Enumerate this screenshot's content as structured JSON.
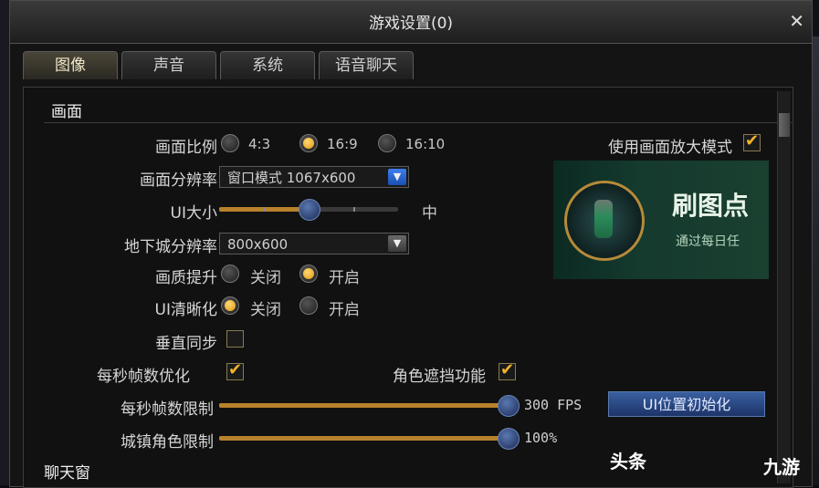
{
  "window": {
    "title": "游戏设置(0)",
    "close_label": "✕"
  },
  "tabs": [
    {
      "label": "图像",
      "active": true
    },
    {
      "label": "声音",
      "active": false
    },
    {
      "label": "系统",
      "active": false
    },
    {
      "label": "语音聊天",
      "active": false
    }
  ],
  "sections": {
    "display": "画面",
    "chat": "聊天窗"
  },
  "aspect_ratio": {
    "label": "画面比例",
    "options": [
      {
        "label": "4:3",
        "selected": false
      },
      {
        "label": "16:9",
        "selected": true
      },
      {
        "label": "16:10",
        "selected": false
      }
    ]
  },
  "zoom_mode": {
    "label": "使用画面放大模式",
    "checked": true
  },
  "resolution": {
    "label": "画面分辨率",
    "value": "窗口模式 1067x600"
  },
  "ui_size": {
    "label": "UI大小",
    "value_label": "中",
    "level": 0.5
  },
  "dungeon_resolution": {
    "label": "地下城分辨率",
    "value": "800x600"
  },
  "quality_boost": {
    "label": "画质提升",
    "options": [
      {
        "label": "关闭",
        "selected": false
      },
      {
        "label": "开启",
        "selected": true
      }
    ]
  },
  "ui_sharpen": {
    "label": "UI清晰化",
    "options": [
      {
        "label": "关闭",
        "selected": true
      },
      {
        "label": "开启",
        "selected": false
      }
    ]
  },
  "vsync": {
    "label": "垂直同步",
    "checked": false
  },
  "fps_optimize": {
    "label": "每秒帧数优化",
    "checked": true
  },
  "character_occlusion": {
    "label": "角色遮挡功能",
    "checked": true
  },
  "fps_limit": {
    "label": "每秒帧数限制",
    "value": "300 FPS",
    "level": 1.0
  },
  "town_character_limit": {
    "label": "城镇角色限制",
    "value": "100%",
    "level": 1.0
  },
  "ui_reset_button": {
    "label": "UI位置初始化"
  },
  "banner": {
    "title": "刷图点",
    "subtitle": "通过每日任"
  },
  "watermarks": {
    "left": "头条",
    "right": "九游"
  },
  "colors": {
    "accent": "#f2b32a",
    "slider_fill": "#b8822c",
    "button_blue": "#3a5fa0"
  }
}
